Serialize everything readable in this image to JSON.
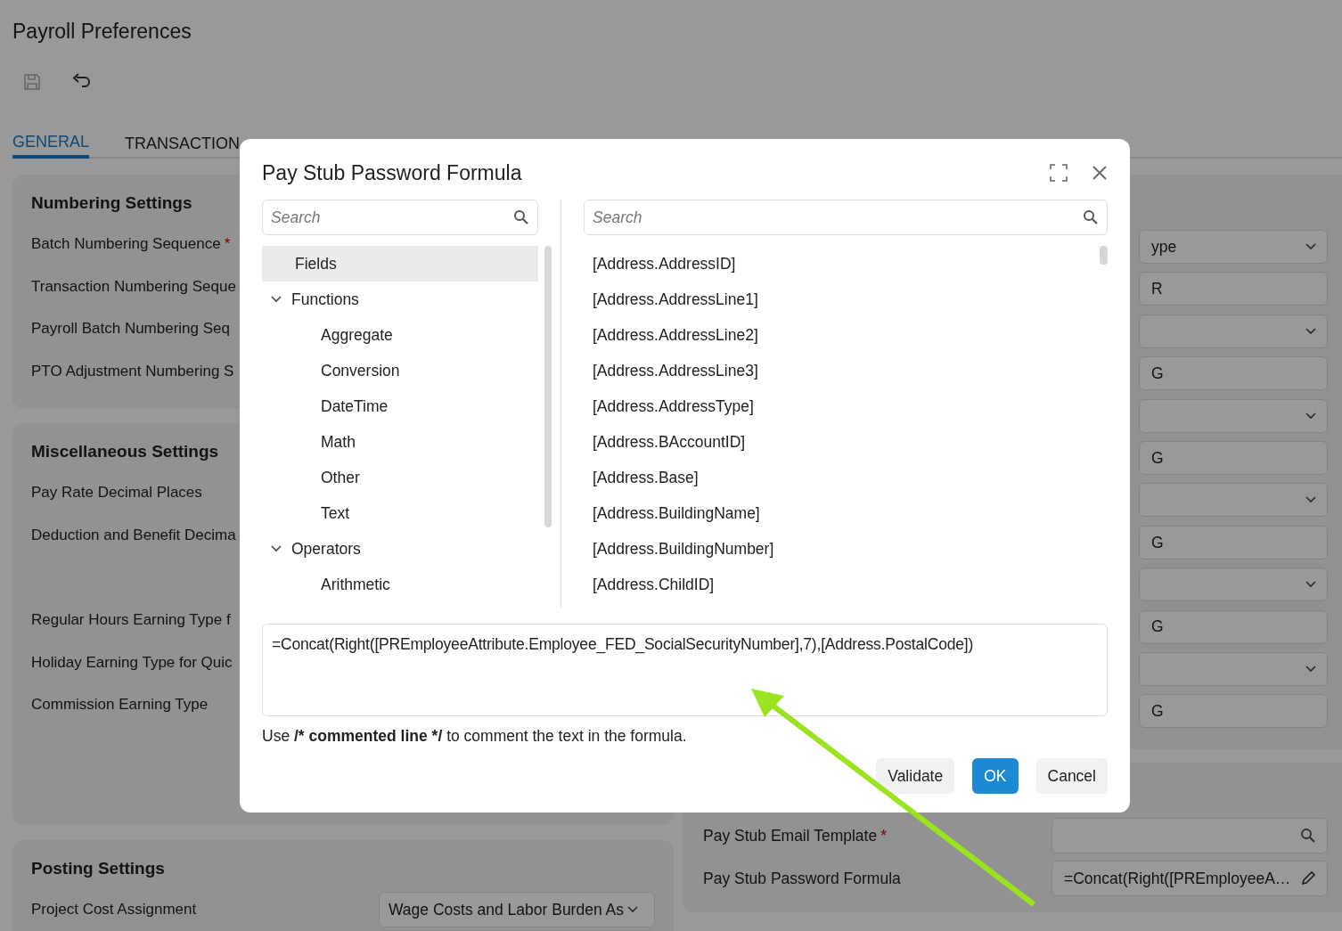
{
  "page": {
    "title": "Payroll Preferences"
  },
  "toolbar": [
    {
      "kind": "save",
      "disabled": true
    },
    {
      "kind": "undo",
      "disabled": false
    }
  ],
  "tabs": [
    {
      "label": "GENERAL",
      "selected": true
    },
    {
      "label": "TRANSACTION",
      "selected": false
    }
  ],
  "left_sections": [
    {
      "title": "Numbering Settings",
      "groups": [
        [
          {
            "label": "Batch Numbering Sequence",
            "required_mark": "*"
          },
          {
            "label": "Transaction Numbering Seque"
          },
          {
            "label": "Payroll Batch Numbering Seq"
          },
          {
            "label": "PTO Adjustment Numbering S"
          }
        ]
      ]
    },
    {
      "title": "Miscellaneous Settings",
      "groups": [
        [
          {
            "label": "Pay Rate Decimal Places"
          },
          {
            "label": "Deduction and Benefit Decima"
          }
        ],
        [
          {
            "label": "Regular Hours Earning Type f"
          },
          {
            "label": "Holiday Earning Type for Quic"
          },
          {
            "label": "Commission Earning Type"
          }
        ]
      ]
    },
    {
      "title": "Posting Settings",
      "groups": [
        [
          {
            "label": "Project Cost Assignment",
            "value": "Wage Costs and Labor Burden As"
          }
        ]
      ]
    }
  ],
  "right_sections": [
    {
      "fields": [
        {
          "kind": "select",
          "value": "ype"
        },
        {
          "kind": "text",
          "value": "R"
        },
        {
          "kind": "select"
        },
        {
          "kind": "text",
          "value": "G"
        },
        {
          "kind": "select"
        },
        {
          "kind": "text",
          "value": "G"
        },
        {
          "kind": "select"
        },
        {
          "kind": "text",
          "value": "G"
        },
        {
          "kind": "select"
        },
        {
          "kind": "text",
          "value": "G"
        },
        {
          "kind": "select"
        },
        {
          "kind": "text",
          "value": "G"
        }
      ]
    },
    {
      "fields": [
        {
          "kind": "lookup",
          "label": "Pay Stub Email Template",
          "required_mark": "*"
        },
        {
          "kind": "formula",
          "label": "Pay Stub Password Formula",
          "value": "=Concat(Right([PREmployeeA…"
        }
      ]
    }
  ],
  "dialog": {
    "title": "Pay Stub Password Formula",
    "left_search": {
      "placeholder": "Search"
    },
    "tree": [
      {
        "label": "Fields",
        "selected": true
      },
      {
        "label": "Functions",
        "selected": false,
        "expanded": true,
        "children": [
          {
            "label": "Aggregate",
            "selected": false
          },
          {
            "label": "Conversion",
            "selected": false
          },
          {
            "label": "DateTime",
            "selected": false
          },
          {
            "label": "Math",
            "selected": false
          },
          {
            "label": "Other",
            "selected": false
          },
          {
            "label": "Text",
            "selected": false
          }
        ]
      },
      {
        "label": "Operators",
        "selected": false,
        "expanded": true,
        "children": [
          {
            "label": "Arithmetic",
            "selected": false
          }
        ]
      }
    ],
    "right_search": {
      "placeholder": "Search"
    },
    "items": [
      "[Address.AddressID]",
      "[Address.AddressLine1]",
      "[Address.AddressLine2]",
      "[Address.AddressLine3]",
      "[Address.AddressType]",
      "[Address.BAccountID]",
      "[Address.Base]",
      "[Address.BuildingName]",
      "[Address.BuildingNumber]",
      "[Address.ChildID]"
    ],
    "formula": "=Concat(Right([PREmployeeAttribute.Employee_FED_SocialSecurityNumber],7),[Address.PostalCode])",
    "hint": {
      "before": "Use ",
      "syntax": "/* commented line */",
      "after": " to comment the text in the formula."
    },
    "buttons": [
      {
        "label": "Validate",
        "kind": "secondary"
      },
      {
        "label": "OK",
        "kind": "primary"
      },
      {
        "label": "Cancel",
        "kind": "secondary"
      }
    ]
  },
  "annotation": {
    "kind": "arrow"
  }
}
